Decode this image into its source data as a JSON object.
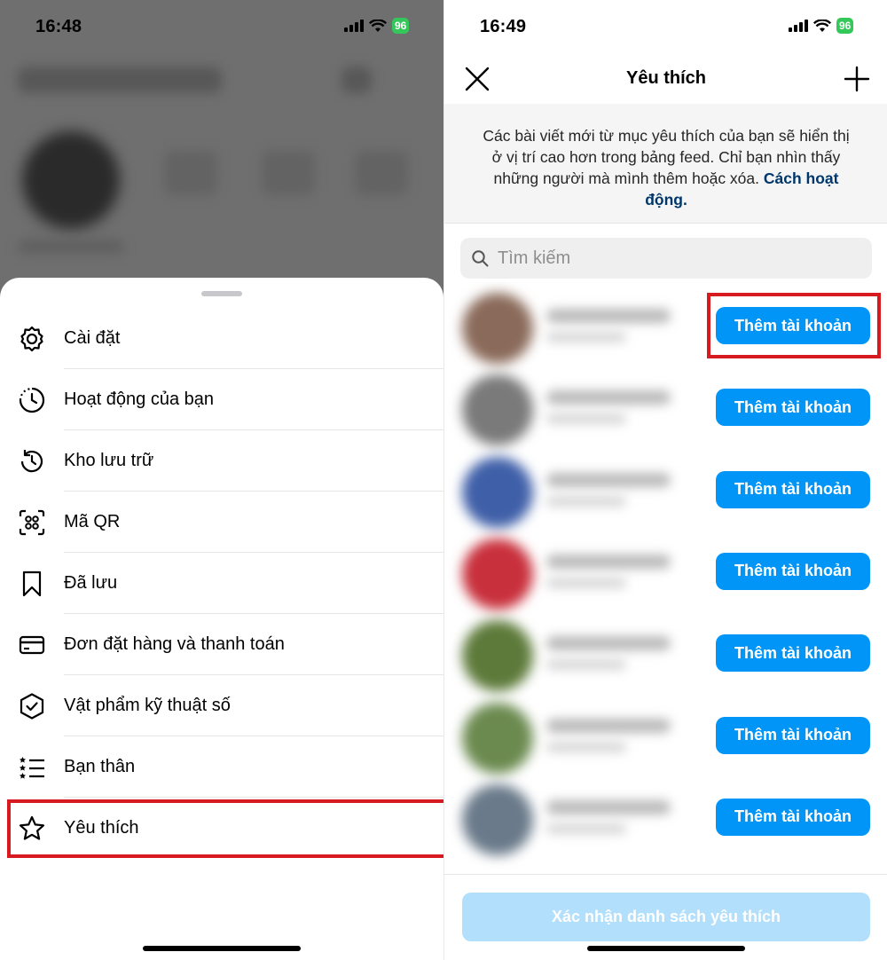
{
  "left": {
    "status": {
      "time": "16:48",
      "battery": "96"
    },
    "menu": [
      {
        "label": "Cài đặt",
        "icon": "gear-icon"
      },
      {
        "label": "Hoạt động của bạn",
        "icon": "activity-icon"
      },
      {
        "label": "Kho lưu trữ",
        "icon": "archive-history-icon"
      },
      {
        "label": "Mã QR",
        "icon": "qr-code-icon"
      },
      {
        "label": "Đã lưu",
        "icon": "bookmark-icon"
      },
      {
        "label": "Đơn đặt hàng và thanh toán",
        "icon": "credit-card-icon"
      },
      {
        "label": "Vật phẩm kỹ thuật số",
        "icon": "shield-check-icon"
      },
      {
        "label": "Bạn thân",
        "icon": "close-friends-list-icon"
      },
      {
        "label": "Yêu thích",
        "icon": "star-icon"
      }
    ]
  },
  "right": {
    "status": {
      "time": "16:49",
      "battery": "96"
    },
    "title": "Yêu thích",
    "info_text": "Các bài viết mới từ mục yêu thích của bạn sẽ hiển thị ở vị trí cao hơn trong bảng feed. Chỉ bạn nhìn thấy những người mà mình thêm hoặc xóa.",
    "info_link": "Cách hoạt động.",
    "search_placeholder": "Tìm kiếm",
    "suggestions": [
      {
        "add_label": "Thêm tài khoản"
      },
      {
        "add_label": "Thêm tài khoản"
      },
      {
        "add_label": "Thêm tài khoản"
      },
      {
        "add_label": "Thêm tài khoản"
      },
      {
        "add_label": "Thêm tài khoản"
      },
      {
        "add_label": "Thêm tài khoản"
      },
      {
        "add_label": "Thêm tài khoản"
      }
    ],
    "confirm_label": "Xác nhận danh sách yêu thích"
  },
  "colors": {
    "accent": "#0095f6",
    "highlight": "#d71920",
    "link": "#00376b"
  }
}
